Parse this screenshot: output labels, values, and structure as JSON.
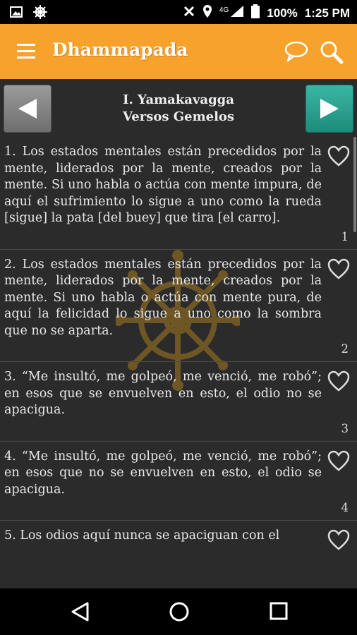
{
  "status": {
    "signal": "4G",
    "battery": "100%",
    "time": "1:25 PM"
  },
  "app": {
    "title": "Dhammapada"
  },
  "chapter": {
    "title": "I. Yamakavagga",
    "subtitle": "Versos Gemelos"
  },
  "verses": [
    {
      "text": "1. Los estados mentales están precedidos por la mente, liderados por la mente, creados por la mente. Si uno habla o actúa con mente impura, de aquí el sufrimiento lo sigue a uno como la rueda [sigue] la pata [del buey] que tira [el carro].",
      "num": "1"
    },
    {
      "text": "2. Los estados mentales están precedidos por la mente, liderados por la mente, creados por la mente. Si uno habla o actúa con mente pura, de aquí la felicidad lo sigue a uno como la sombra que no se aparta.",
      "num": "2"
    },
    {
      "text": "3. “Me insultó, me golpeó, me venció, me robó”; en esos que se envuelven en esto, el odio no se apacigua.",
      "num": "3"
    },
    {
      "text": "4. “Me insultó, me golpeó, me venció, me robó”; en esos que no se envuelven en esto, el odio se apacigua.",
      "num": "4"
    },
    {
      "text": "5. Los odios aquí nunca se apaciguan con el",
      "num": ""
    }
  ],
  "icons": {
    "status_left": [
      "image-icon",
      "dharma-wheel-icon"
    ],
    "status_right": [
      "mute-icon",
      "location-icon",
      "signal-icon",
      "battery-icon"
    ],
    "appbar": [
      "menu-icon",
      "chat-icon",
      "search-icon"
    ],
    "nav": [
      "back-icon",
      "home-icon",
      "recents-icon"
    ]
  },
  "colors": {
    "appbar": "#f6a22c",
    "next_button": "#2a9f8c",
    "background": "#2b2b2b"
  }
}
